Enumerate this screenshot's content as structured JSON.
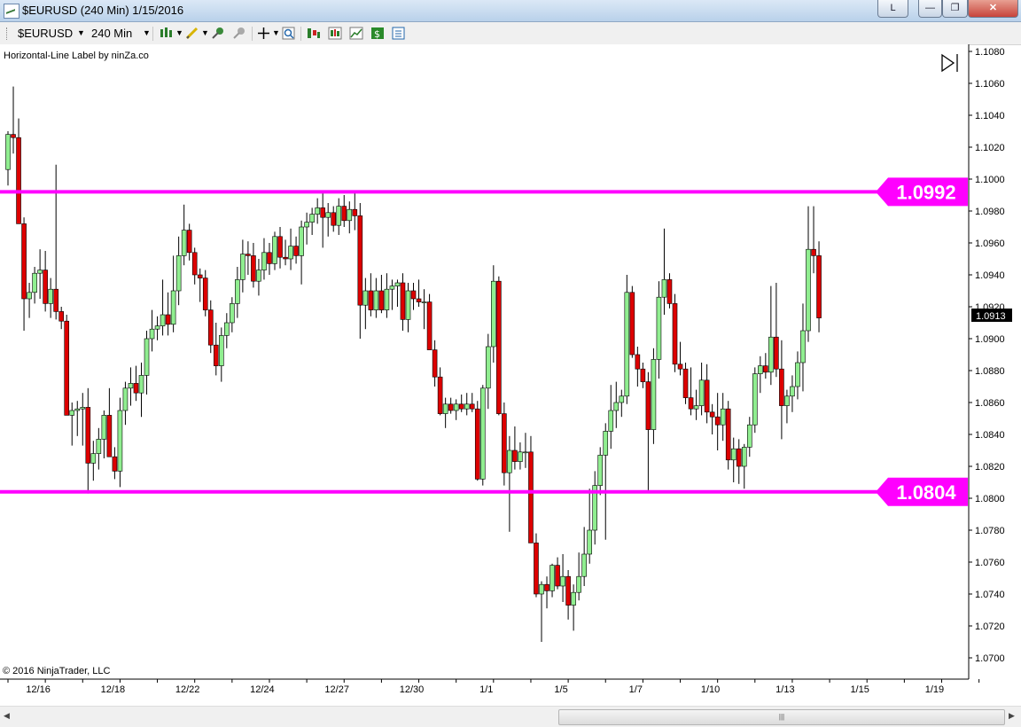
{
  "window": {
    "title": "$EURUSD (240 Min)  1/15/2016",
    "link_button": "L"
  },
  "toolbar": {
    "instrument": "$EURUSD",
    "interval": "240 Min",
    "icons": [
      "bar-style-icon",
      "drawing-tool-icon",
      "pin-icon",
      "pin-disabled-icon",
      "crosshair-icon",
      "zoom-icon",
      "strategy-icon",
      "indicator-icon",
      "chart-icon",
      "dollar-icon",
      "properties-icon"
    ]
  },
  "chart": {
    "indicator_label": "Horizontal-Line Label by ninZa.co",
    "copyright": "© 2016 NinjaTrader, LLC",
    "y_ticks": [
      "1.1080",
      "1.1060",
      "1.1040",
      "1.1020",
      "1.1000",
      "1.0980",
      "1.0960",
      "1.0940",
      "1.0920",
      "1.0900",
      "1.0880",
      "1.0860",
      "1.0840",
      "1.0820",
      "1.0800",
      "1.0780",
      "1.0760",
      "1.0740",
      "1.0720",
      "1.0700"
    ],
    "x_ticks": [
      "12/16",
      "12/18",
      "12/22",
      "12/24",
      "12/27",
      "12/30",
      "1/1",
      "1/5",
      "1/7",
      "1/10",
      "1/13",
      "1/15",
      "1/19"
    ],
    "current_price": "1.0913",
    "colors": {
      "up": "#90ee90",
      "down": "#dd0000",
      "outline": "#000000",
      "hline": "#ff00ff",
      "label_text": "#ffffff"
    }
  },
  "chart_data": {
    "type": "candlestick",
    "title": "",
    "ylim": [
      1.069,
      1.1083
    ],
    "candles": [
      {
        "o": 1.1006,
        "h": 1.103,
        "l": 1.0996,
        "c": 1.1028
      },
      {
        "o": 1.1028,
        "h": 1.1058,
        "l": 1.1016,
        "c": 1.1026
      },
      {
        "o": 1.1026,
        "h": 1.1038,
        "l": 1.0973,
        "c": 1.0972
      },
      {
        "o": 1.0972,
        "h": 1.0976,
        "l": 1.0905,
        "c": 1.0925
      },
      {
        "o": 1.0925,
        "h": 1.0935,
        "l": 1.0913,
        "c": 1.0929
      },
      {
        "o": 1.0929,
        "h": 1.0945,
        "l": 1.0922,
        "c": 1.0941
      },
      {
        "o": 1.0941,
        "h": 1.0956,
        "l": 1.0925,
        "c": 1.0943
      },
      {
        "o": 1.0943,
        "h": 1.0955,
        "l": 1.0917,
        "c": 1.0922
      },
      {
        "o": 1.0922,
        "h": 1.0938,
        "l": 1.0913,
        "c": 1.0931
      },
      {
        "o": 1.0931,
        "h": 1.1009,
        "l": 1.0912,
        "c": 1.0917
      },
      {
        "o": 1.0917,
        "h": 1.092,
        "l": 1.0906,
        "c": 1.0911
      },
      {
        "o": 1.0911,
        "h": 1.0915,
        "l": 1.0852,
        "c": 1.0852
      },
      {
        "o": 1.0852,
        "h": 1.086,
        "l": 1.0833,
        "c": 1.0855
      },
      {
        "o": 1.0855,
        "h": 1.0861,
        "l": 1.0839,
        "c": 1.0856
      },
      {
        "o": 1.0856,
        "h": 1.0866,
        "l": 1.0833,
        "c": 1.0857
      },
      {
        "o": 1.0857,
        "h": 1.0869,
        "l": 1.0803,
        "c": 1.0822
      },
      {
        "o": 1.0822,
        "h": 1.0836,
        "l": 1.0811,
        "c": 1.0828
      },
      {
        "o": 1.0828,
        "h": 1.0844,
        "l": 1.0818,
        "c": 1.0837
      },
      {
        "o": 1.0837,
        "h": 1.0855,
        "l": 1.0825,
        "c": 1.0852
      },
      {
        "o": 1.0852,
        "h": 1.0869,
        "l": 1.0831,
        "c": 1.0826
      },
      {
        "o": 1.0826,
        "h": 1.0832,
        "l": 1.0812,
        "c": 1.0817
      },
      {
        "o": 1.0817,
        "h": 1.0863,
        "l": 1.0807,
        "c": 1.0855
      },
      {
        "o": 1.0855,
        "h": 1.0873,
        "l": 1.0846,
        "c": 1.0869
      },
      {
        "o": 1.0869,
        "h": 1.0882,
        "l": 1.0858,
        "c": 1.0872
      },
      {
        "o": 1.0872,
        "h": 1.0883,
        "l": 1.0861,
        "c": 1.0866
      },
      {
        "o": 1.0866,
        "h": 1.0885,
        "l": 1.0851,
        "c": 1.0877
      },
      {
        "o": 1.0877,
        "h": 1.0905,
        "l": 1.0865,
        "c": 1.09
      },
      {
        "o": 1.09,
        "h": 1.0918,
        "l": 1.0892,
        "c": 1.0906
      },
      {
        "o": 1.0906,
        "h": 1.0914,
        "l": 1.0899,
        "c": 1.0908
      },
      {
        "o": 1.0908,
        "h": 1.0937,
        "l": 1.0902,
        "c": 1.0915
      },
      {
        "o": 1.0915,
        "h": 1.0929,
        "l": 1.0902,
        "c": 1.0909
      },
      {
        "o": 1.0909,
        "h": 1.0952,
        "l": 1.0904,
        "c": 1.093
      },
      {
        "o": 1.093,
        "h": 1.0964,
        "l": 1.0921,
        "c": 1.0952
      },
      {
        "o": 1.0952,
        "h": 1.0984,
        "l": 1.0946,
        "c": 1.0968
      },
      {
        "o": 1.0968,
        "h": 1.0972,
        "l": 1.0949,
        "c": 1.0954
      },
      {
        "o": 1.0954,
        "h": 1.0957,
        "l": 1.0934,
        "c": 1.094
      },
      {
        "o": 1.094,
        "h": 1.0944,
        "l": 1.0923,
        "c": 1.0938
      },
      {
        "o": 1.0938,
        "h": 1.0943,
        "l": 1.0914,
        "c": 1.0918
      },
      {
        "o": 1.0918,
        "h": 1.0924,
        "l": 1.0891,
        "c": 1.0896
      },
      {
        "o": 1.0896,
        "h": 1.091,
        "l": 1.0877,
        "c": 1.0883
      },
      {
        "o": 1.0883,
        "h": 1.0907,
        "l": 1.0873,
        "c": 1.0902
      },
      {
        "o": 1.0902,
        "h": 1.0916,
        "l": 1.0894,
        "c": 1.091
      },
      {
        "o": 1.091,
        "h": 1.0926,
        "l": 1.0904,
        "c": 1.0922
      },
      {
        "o": 1.0922,
        "h": 1.0945,
        "l": 1.0913,
        "c": 1.0937
      },
      {
        "o": 1.0937,
        "h": 1.0962,
        "l": 1.0929,
        "c": 1.0953
      },
      {
        "o": 1.0953,
        "h": 1.0961,
        "l": 1.094,
        "c": 1.0952
      },
      {
        "o": 1.0952,
        "h": 1.096,
        "l": 1.0932,
        "c": 1.0936
      },
      {
        "o": 1.0936,
        "h": 1.095,
        "l": 1.0927,
        "c": 1.0943
      },
      {
        "o": 1.0943,
        "h": 1.0963,
        "l": 1.0937,
        "c": 1.0954
      },
      {
        "o": 1.0954,
        "h": 1.096,
        "l": 1.094,
        "c": 1.0947
      },
      {
        "o": 1.0947,
        "h": 1.0967,
        "l": 1.0943,
        "c": 1.0964
      },
      {
        "o": 1.0964,
        "h": 1.097,
        "l": 1.0944,
        "c": 1.0951
      },
      {
        "o": 1.0951,
        "h": 1.0962,
        "l": 1.0946,
        "c": 1.095
      },
      {
        "o": 1.095,
        "h": 1.0969,
        "l": 1.0943,
        "c": 1.0958
      },
      {
        "o": 1.0958,
        "h": 1.0964,
        "l": 1.0947,
        "c": 1.0952
      },
      {
        "o": 1.0952,
        "h": 1.0974,
        "l": 1.0934,
        "c": 1.097
      },
      {
        "o": 1.097,
        "h": 1.0979,
        "l": 1.0959,
        "c": 1.0973
      },
      {
        "o": 1.0973,
        "h": 1.0982,
        "l": 1.0965,
        "c": 1.0978
      },
      {
        "o": 1.0978,
        "h": 1.0988,
        "l": 1.0972,
        "c": 1.0982
      },
      {
        "o": 1.0982,
        "h": 1.0992,
        "l": 1.0957,
        "c": 1.0976
      },
      {
        "o": 1.0976,
        "h": 1.0985,
        "l": 1.0964,
        "c": 1.0979
      },
      {
        "o": 1.0979,
        "h": 1.0983,
        "l": 1.0967,
        "c": 1.0971
      },
      {
        "o": 1.0971,
        "h": 1.0988,
        "l": 1.0965,
        "c": 1.0983
      },
      {
        "o": 1.0983,
        "h": 1.099,
        "l": 1.097,
        "c": 1.0974
      },
      {
        "o": 1.0974,
        "h": 1.0986,
        "l": 1.0966,
        "c": 1.0981
      },
      {
        "o": 1.0981,
        "h": 1.0992,
        "l": 1.0968,
        "c": 1.0977
      },
      {
        "o": 1.0977,
        "h": 1.0985,
        "l": 1.09,
        "c": 1.0921
      },
      {
        "o": 1.0921,
        "h": 1.0938,
        "l": 1.0906,
        "c": 1.093
      },
      {
        "o": 1.093,
        "h": 1.0941,
        "l": 1.0914,
        "c": 1.0918
      },
      {
        "o": 1.0918,
        "h": 1.0938,
        "l": 1.0913,
        "c": 1.093
      },
      {
        "o": 1.093,
        "h": 1.094,
        "l": 1.0916,
        "c": 1.0918
      },
      {
        "o": 1.0918,
        "h": 1.0941,
        "l": 1.0913,
        "c": 1.0931
      },
      {
        "o": 1.0931,
        "h": 1.0937,
        "l": 1.0918,
        "c": 1.0933
      },
      {
        "o": 1.0933,
        "h": 1.0937,
        "l": 1.092,
        "c": 1.0935
      },
      {
        "o": 1.0935,
        "h": 1.0941,
        "l": 1.0905,
        "c": 1.0912
      },
      {
        "o": 1.0912,
        "h": 1.0935,
        "l": 1.0904,
        "c": 1.093
      },
      {
        "o": 1.093,
        "h": 1.0935,
        "l": 1.0918,
        "c": 1.0925
      },
      {
        "o": 1.0925,
        "h": 1.0937,
        "l": 1.092,
        "c": 1.0923
      },
      {
        "o": 1.0923,
        "h": 1.0931,
        "l": 1.0906,
        "c": 1.0923
      },
      {
        "o": 1.0923,
        "h": 1.0928,
        "l": 1.0898,
        "c": 1.0893
      },
      {
        "o": 1.0893,
        "h": 1.0899,
        "l": 1.087,
        "c": 1.0876
      },
      {
        "o": 1.0876,
        "h": 1.0882,
        "l": 1.0852,
        "c": 1.0853
      },
      {
        "o": 1.0853,
        "h": 1.0863,
        "l": 1.0844,
        "c": 1.0859
      },
      {
        "o": 1.0859,
        "h": 1.0863,
        "l": 1.0853,
        "c": 1.0855
      },
      {
        "o": 1.0855,
        "h": 1.0862,
        "l": 1.0849,
        "c": 1.0859
      },
      {
        "o": 1.0859,
        "h": 1.0865,
        "l": 1.0854,
        "c": 1.0856
      },
      {
        "o": 1.0856,
        "h": 1.0866,
        "l": 1.0852,
        "c": 1.0859
      },
      {
        "o": 1.0859,
        "h": 1.0866,
        "l": 1.0854,
        "c": 1.0856
      },
      {
        "o": 1.0856,
        "h": 1.0861,
        "l": 1.0811,
        "c": 1.0812
      },
      {
        "o": 1.0812,
        "h": 1.0871,
        "l": 1.0808,
        "c": 1.0869
      },
      {
        "o": 1.0869,
        "h": 1.0903,
        "l": 1.0856,
        "c": 1.0895
      },
      {
        "o": 1.0895,
        "h": 1.0946,
        "l": 1.0885,
        "c": 1.0936
      },
      {
        "o": 1.0936,
        "h": 1.0939,
        "l": 1.0852,
        "c": 1.0853
      },
      {
        "o": 1.0853,
        "h": 1.086,
        "l": 1.0808,
        "c": 1.0816
      },
      {
        "o": 1.0816,
        "h": 1.0839,
        "l": 1.0779,
        "c": 1.083
      },
      {
        "o": 1.083,
        "h": 1.0845,
        "l": 1.0818,
        "c": 1.0823
      },
      {
        "o": 1.0823,
        "h": 1.0835,
        "l": 1.0818,
        "c": 1.0829
      },
      {
        "o": 1.0829,
        "h": 1.0841,
        "l": 1.0819,
        "c": 1.0829
      },
      {
        "o": 1.0829,
        "h": 1.0839,
        "l": 1.0772,
        "c": 1.0772
      },
      {
        "o": 1.0772,
        "h": 1.0778,
        "l": 1.0738,
        "c": 1.074
      },
      {
        "o": 1.074,
        "h": 1.0748,
        "l": 1.071,
        "c": 1.0746
      },
      {
        "o": 1.0746,
        "h": 1.0751,
        "l": 1.0731,
        "c": 1.0742
      },
      {
        "o": 1.0742,
        "h": 1.0759,
        "l": 1.0738,
        "c": 1.0758
      },
      {
        "o": 1.0758,
        "h": 1.0763,
        "l": 1.0743,
        "c": 1.0745
      },
      {
        "o": 1.0745,
        "h": 1.0765,
        "l": 1.0735,
        "c": 1.0751
      },
      {
        "o": 1.0751,
        "h": 1.0755,
        "l": 1.0724,
        "c": 1.0733
      },
      {
        "o": 1.0733,
        "h": 1.0746,
        "l": 1.0717,
        "c": 1.0741
      },
      {
        "o": 1.0741,
        "h": 1.0766,
        "l": 1.0736,
        "c": 1.0751
      },
      {
        "o": 1.0751,
        "h": 1.0782,
        "l": 1.0745,
        "c": 1.0765
      },
      {
        "o": 1.0765,
        "h": 1.0806,
        "l": 1.0759,
        "c": 1.078
      },
      {
        "o": 1.078,
        "h": 1.0817,
        "l": 1.0771,
        "c": 1.0808
      },
      {
        "o": 1.0808,
        "h": 1.0832,
        "l": 1.0802,
        "c": 1.0827
      },
      {
        "o": 1.0827,
        "h": 1.0847,
        "l": 1.0774,
        "c": 1.0842
      },
      {
        "o": 1.0842,
        "h": 1.0871,
        "l": 1.0831,
        "c": 1.0855
      },
      {
        "o": 1.0855,
        "h": 1.0873,
        "l": 1.0844,
        "c": 1.086
      },
      {
        "o": 1.086,
        "h": 1.0868,
        "l": 1.0851,
        "c": 1.0864
      },
      {
        "o": 1.0864,
        "h": 1.094,
        "l": 1.0859,
        "c": 1.0929
      },
      {
        "o": 1.0929,
        "h": 1.0933,
        "l": 1.0888,
        "c": 1.089
      },
      {
        "o": 1.089,
        "h": 1.0895,
        "l": 1.087,
        "c": 1.0881
      },
      {
        "o": 1.0881,
        "h": 1.0885,
        "l": 1.0869,
        "c": 1.0873
      },
      {
        "o": 1.0873,
        "h": 1.0879,
        "l": 1.0804,
        "c": 1.0843
      },
      {
        "o": 1.0843,
        "h": 1.0894,
        "l": 1.0834,
        "c": 1.0887
      },
      {
        "o": 1.0887,
        "h": 1.0936,
        "l": 1.0875,
        "c": 1.0926
      },
      {
        "o": 1.0926,
        "h": 1.0969,
        "l": 1.0915,
        "c": 1.0937
      },
      {
        "o": 1.0937,
        "h": 1.0941,
        "l": 1.0919,
        "c": 1.0922
      },
      {
        "o": 1.0922,
        "h": 1.0928,
        "l": 1.0879,
        "c": 1.0884
      },
      {
        "o": 1.0884,
        "h": 1.0898,
        "l": 1.0877,
        "c": 1.0881
      },
      {
        "o": 1.0881,
        "h": 1.0885,
        "l": 1.0859,
        "c": 1.0863
      },
      {
        "o": 1.0863,
        "h": 1.0882,
        "l": 1.0852,
        "c": 1.0856
      },
      {
        "o": 1.0856,
        "h": 1.0868,
        "l": 1.0849,
        "c": 1.0858
      },
      {
        "o": 1.0858,
        "h": 1.0885,
        "l": 1.0852,
        "c": 1.0874
      },
      {
        "o": 1.0874,
        "h": 1.0884,
        "l": 1.0847,
        "c": 1.0854
      },
      {
        "o": 1.0854,
        "h": 1.0859,
        "l": 1.084,
        "c": 1.0851
      },
      {
        "o": 1.0851,
        "h": 1.0866,
        "l": 1.083,
        "c": 1.0846
      },
      {
        "o": 1.0846,
        "h": 1.0866,
        "l": 1.0836,
        "c": 1.0856
      },
      {
        "o": 1.0856,
        "h": 1.0861,
        "l": 1.0818,
        "c": 1.0824
      },
      {
        "o": 1.0824,
        "h": 1.0838,
        "l": 1.081,
        "c": 1.0831
      },
      {
        "o": 1.0831,
        "h": 1.0837,
        "l": 1.0809,
        "c": 1.082
      },
      {
        "o": 1.082,
        "h": 1.0834,
        "l": 1.0806,
        "c": 1.0832
      },
      {
        "o": 1.0832,
        "h": 1.0851,
        "l": 1.0826,
        "c": 1.0846
      },
      {
        "o": 1.0846,
        "h": 1.0882,
        "l": 1.0841,
        "c": 1.0878
      },
      {
        "o": 1.0878,
        "h": 1.0889,
        "l": 1.0866,
        "c": 1.0883
      },
      {
        "o": 1.0883,
        "h": 1.0891,
        "l": 1.0875,
        "c": 1.0879
      },
      {
        "o": 1.0879,
        "h": 1.0933,
        "l": 1.0871,
        "c": 1.0901
      },
      {
        "o": 1.0901,
        "h": 1.0935,
        "l": 1.0876,
        "c": 1.0881
      },
      {
        "o": 1.0881,
        "h": 1.0899,
        "l": 1.0837,
        "c": 1.0858
      },
      {
        "o": 1.0858,
        "h": 1.0868,
        "l": 1.0847,
        "c": 1.0864
      },
      {
        "o": 1.0864,
        "h": 1.0877,
        "l": 1.0854,
        "c": 1.087
      },
      {
        "o": 1.087,
        "h": 1.0892,
        "l": 1.0862,
        "c": 1.0885
      },
      {
        "o": 1.0885,
        "h": 1.0922,
        "l": 1.0867,
        "c": 1.0905
      },
      {
        "o": 1.0905,
        "h": 1.0983,
        "l": 1.0898,
        "c": 1.0956
      },
      {
        "o": 1.0956,
        "h": 1.0983,
        "l": 1.0941,
        "c": 1.0952
      },
      {
        "o": 1.0952,
        "h": 1.0961,
        "l": 1.0904,
        "c": 1.0913
      }
    ],
    "horizontal_lines": [
      {
        "price": 1.0992,
        "label": "1.0992"
      },
      {
        "price": 1.0804,
        "label": "1.0804"
      }
    ],
    "x_tick_bar_index": [
      4,
      18,
      32,
      46,
      60,
      74,
      88,
      102,
      116,
      130,
      144,
      158,
      172
    ]
  }
}
